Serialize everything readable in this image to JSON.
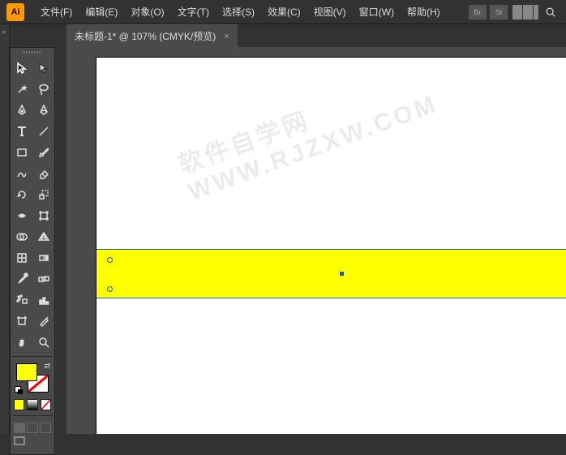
{
  "app": {
    "logo": "Ai"
  },
  "menu": {
    "file": "文件(F)",
    "edit": "编辑(E)",
    "object": "对象(O)",
    "type": "文字(T)",
    "select": "选择(S)",
    "effect": "效果(C)",
    "view": "视图(V)",
    "window": "窗口(W)",
    "help": "帮助(H)"
  },
  "right_icons": {
    "br": "Br",
    "st": "St"
  },
  "tab": {
    "title": "未标题-1* @ 107% (CMYK/预览)",
    "close": "×"
  },
  "tools": {
    "selection": "selection",
    "direct": "direct-selection",
    "wand": "magic-wand",
    "lasso": "lasso",
    "pen": "pen",
    "curvature": "curvature-pen",
    "type": "type",
    "line": "line-segment",
    "rectangle": "rectangle",
    "paintbrush": "paintbrush",
    "shaper": "shaper",
    "eraser": "eraser",
    "rotate": "rotate",
    "scale": "scale",
    "width": "width",
    "free-transform": "free-transform",
    "shape-builder": "shape-builder",
    "perspective": "perspective-grid",
    "mesh": "mesh",
    "gradient": "gradient",
    "eyedropper": "eyedropper",
    "blend": "blend",
    "symbol-sprayer": "symbol-sprayer",
    "column-graph": "column-graph",
    "artboard": "artboard",
    "slice": "slice",
    "hand": "hand",
    "zoom": "zoom"
  },
  "colors": {
    "fill": "#ffff00",
    "stroke": "none",
    "mini": [
      "#ffff00",
      "#888888",
      "#ff0000"
    ]
  },
  "canvas": {
    "shape": {
      "type": "rectangle",
      "fill": "#ffff00",
      "selected": true
    }
  },
  "watermark": "软件自学网 WWW.RJZXW.COM"
}
